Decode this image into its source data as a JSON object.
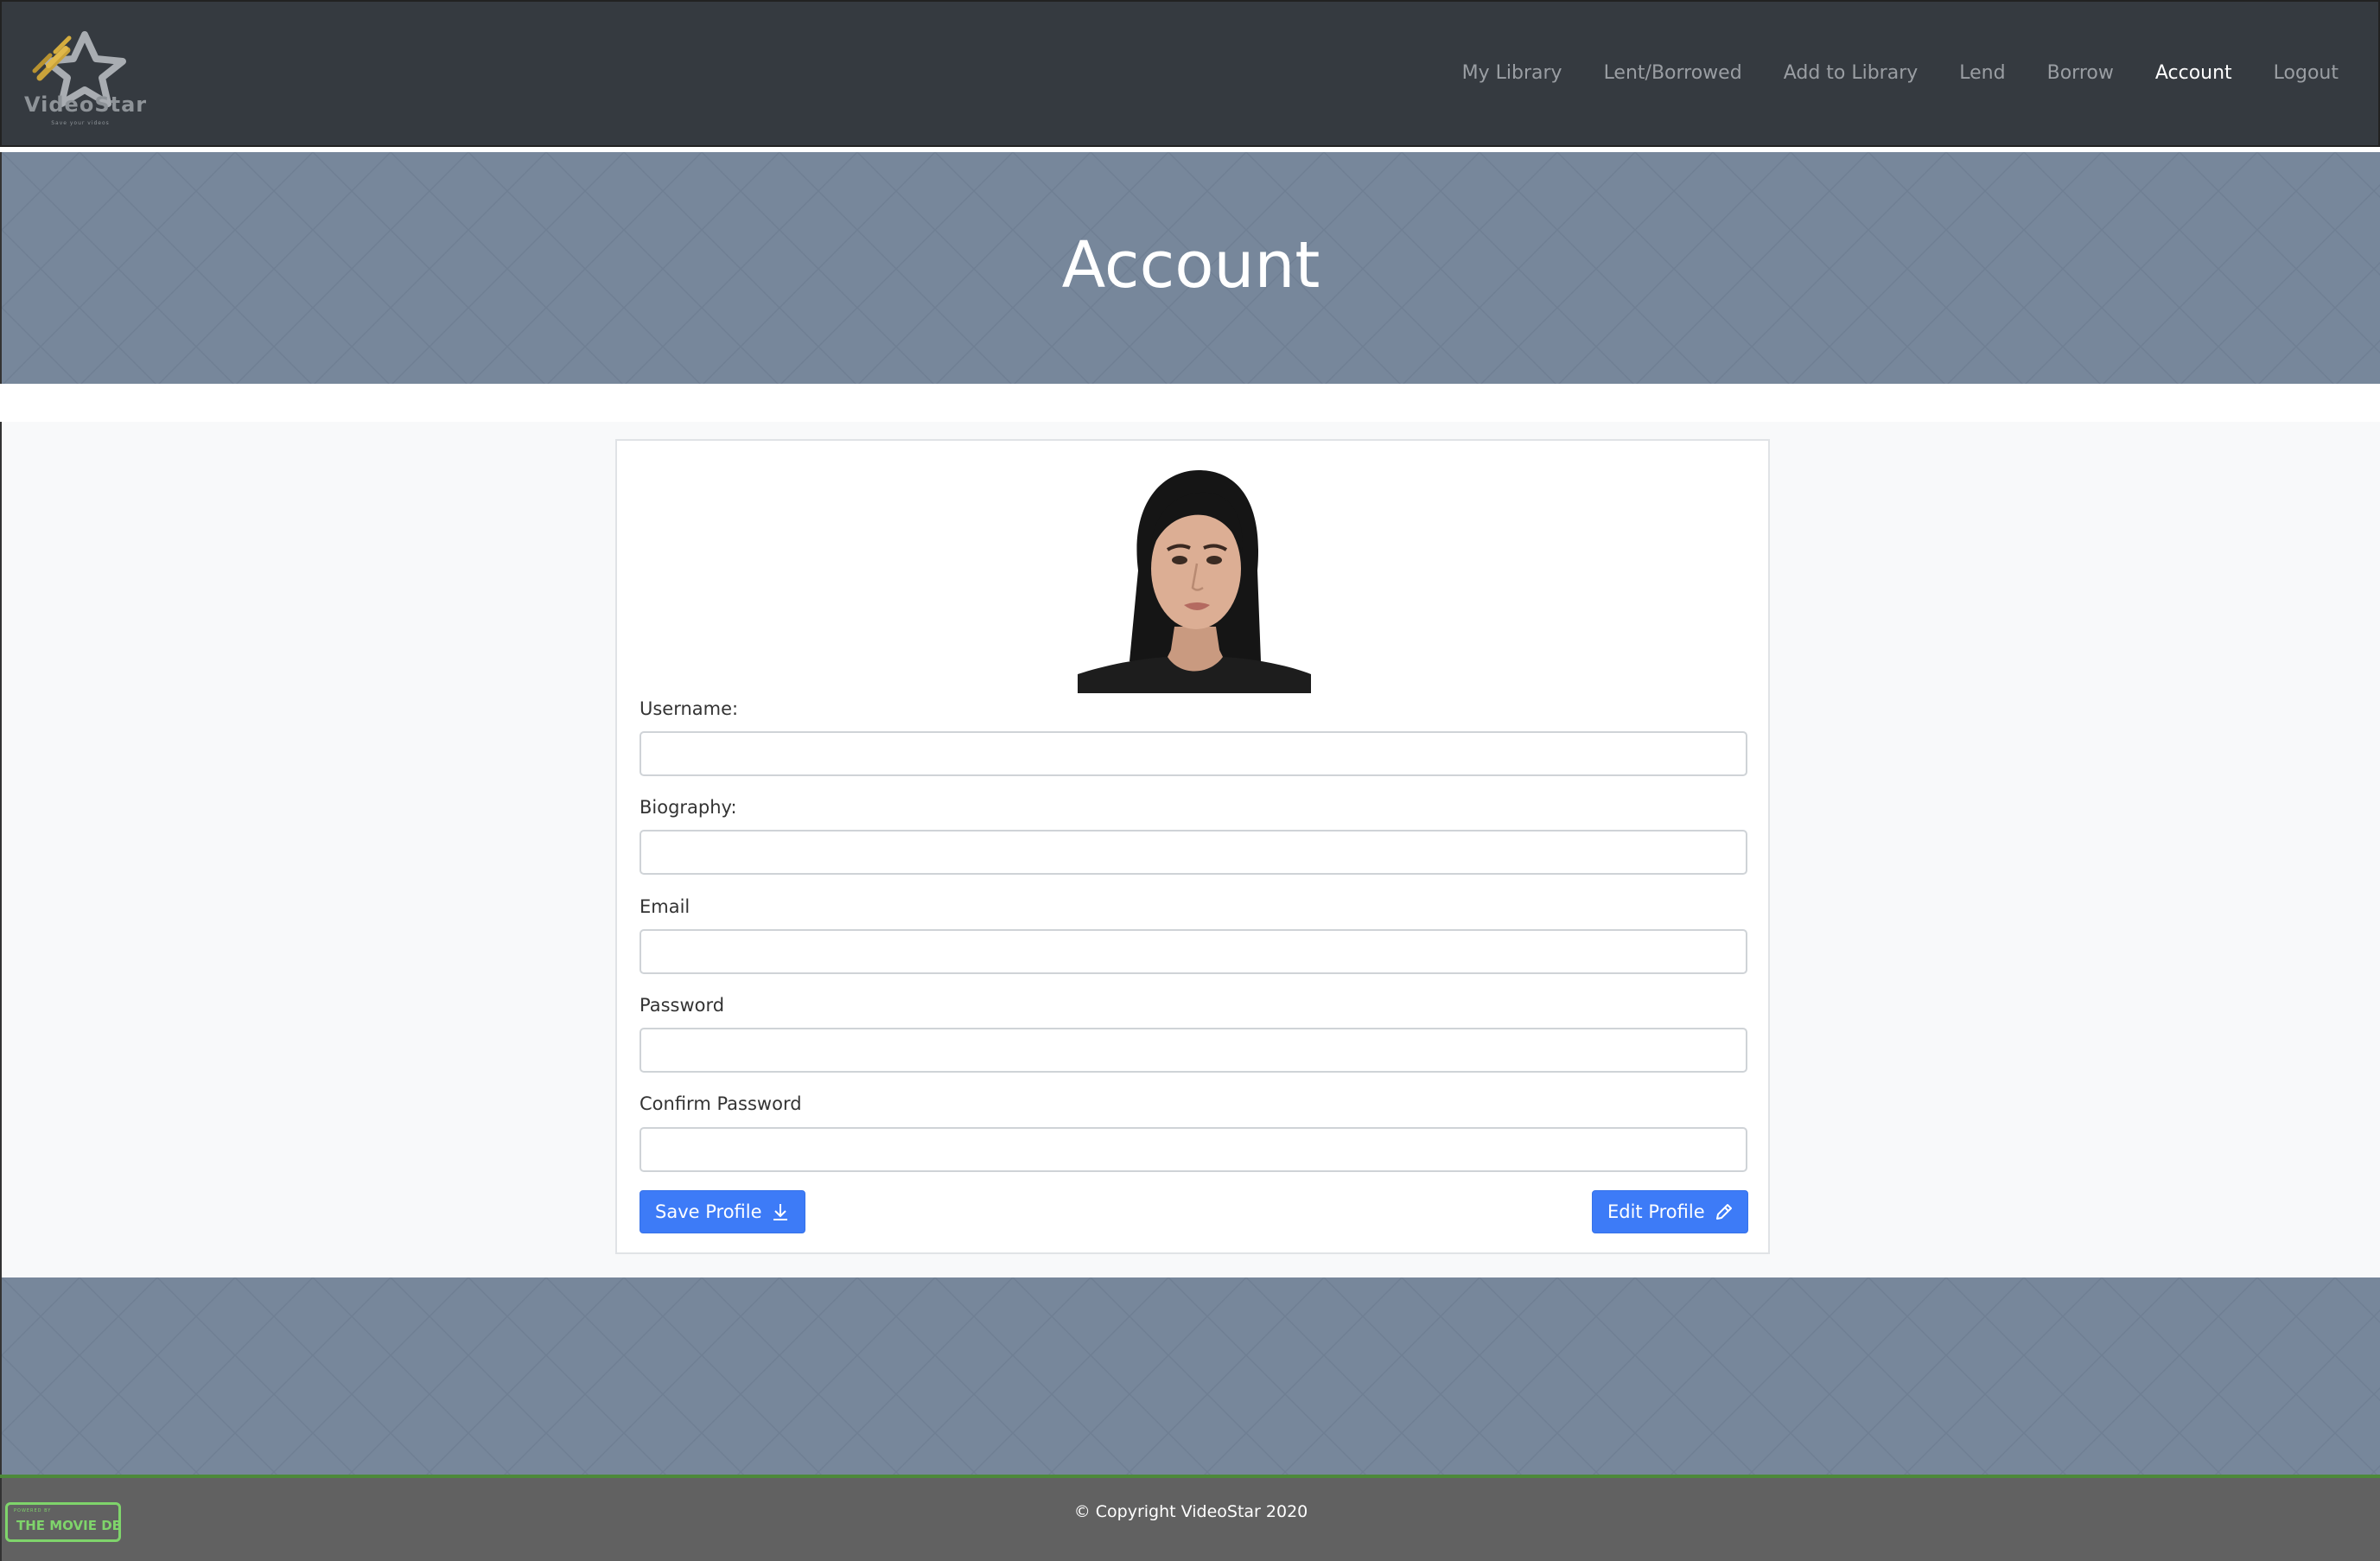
{
  "brand": {
    "name": "VideoStar",
    "tagline": "Save your videos"
  },
  "nav": {
    "items": [
      {
        "label": "My Library"
      },
      {
        "label": "Lent/Borrowed"
      },
      {
        "label": "Add to Library"
      },
      {
        "label": "Lend"
      },
      {
        "label": "Borrow"
      },
      {
        "label": "Account",
        "active": true
      },
      {
        "label": "Logout"
      }
    ]
  },
  "hero": {
    "title": "Account"
  },
  "form": {
    "username_label": "Username:",
    "username_value": "",
    "biography_label": "Biography:",
    "biography_value": "",
    "email_label": "Email",
    "email_value": "",
    "password_label": "Password",
    "password_value": "",
    "confirm_label": "Confirm Password",
    "confirm_value": "",
    "save_label": "Save Profile",
    "edit_label": "Edit Profile"
  },
  "footer": {
    "copyright": "© Copyright VideoStar 2020",
    "tmdb_small": "POWERED BY",
    "tmdb_big": "THE MOVIE DB"
  },
  "colors": {
    "navbar": "#353a40",
    "accent": "#3d7bf7",
    "hero": "#77879b",
    "footer": "#616161",
    "tmdb_green": "#7fd46b"
  }
}
